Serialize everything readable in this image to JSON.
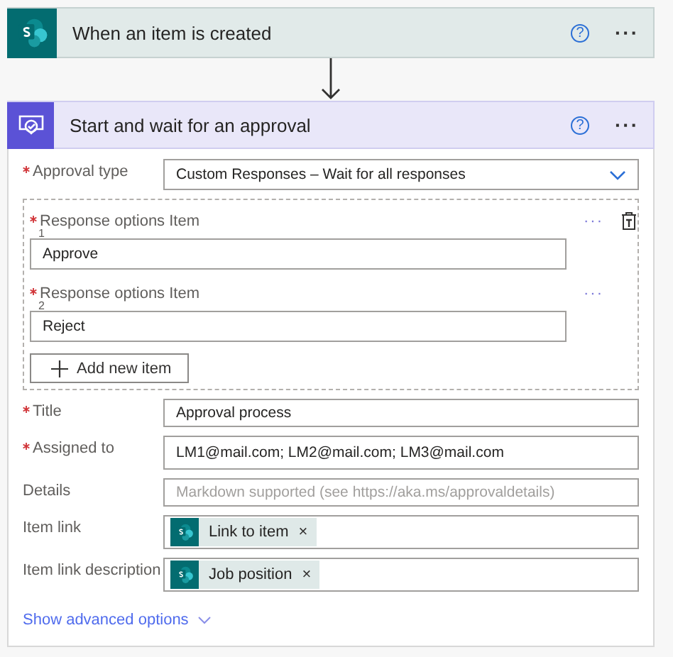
{
  "trigger": {
    "kind": "sharepoint",
    "title": "When an item is created",
    "help": "?",
    "more": "···"
  },
  "action": {
    "kind": "approval",
    "title": "Start and wait for an approval",
    "help": "?",
    "more": "···",
    "approval_type": {
      "label": "Approval type",
      "required": true,
      "value": "Custom Responses – Wait for all responses"
    },
    "response_items": [
      {
        "label": "Response options Item",
        "index": "1",
        "required": true,
        "value": "Approve",
        "more": "···"
      },
      {
        "label": "Response options Item",
        "index": "2",
        "required": true,
        "value": "Reject",
        "more": "···"
      }
    ],
    "add_button": "Add new item",
    "fields": [
      {
        "kind": "text",
        "label": "Title",
        "required": true,
        "value": "Approval process"
      },
      {
        "kind": "text",
        "label": "Assigned to",
        "required": true,
        "value": "LM1@mail.com; LM2@mail.com; LM3@mail.com"
      },
      {
        "kind": "placeholder",
        "label": "Details",
        "required": false,
        "placeholder": "Markdown supported (see https://aka.ms/approvaldetails)"
      },
      {
        "kind": "token",
        "label": "Item link",
        "required": false,
        "token": "Link to item",
        "remove": "×"
      },
      {
        "kind": "token",
        "label": "Item link description",
        "required": false,
        "token": "Job position",
        "remove": "×"
      }
    ],
    "advanced_link": "Show advanced options"
  }
}
